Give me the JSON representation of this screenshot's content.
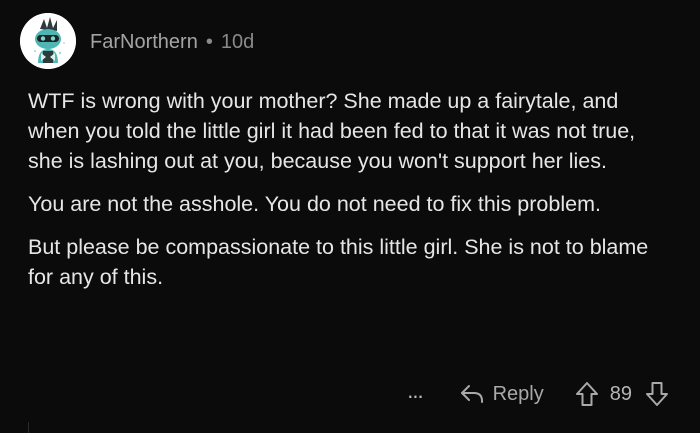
{
  "comment": {
    "username": "FarNorthern",
    "separator": "•",
    "age": "10d",
    "paragraphs": [
      "WTF is wrong with your mother? She made up a fairytale, and when you told the little girl it had been fed to that it was not true, she is lashing out at you, because you won't support her lies.",
      "You are not the asshole. You do not need to fix this problem.",
      "But please be compassionate to this little girl. She is not to blame for any of this."
    ]
  },
  "actions": {
    "more_label": "...",
    "reply_label": "Reply",
    "score": "89"
  },
  "icons": {
    "avatar": "snoo-avatar-icon",
    "reply": "reply-arrow-icon",
    "upvote": "upvote-arrow-icon",
    "downvote": "downvote-arrow-icon"
  },
  "colors": {
    "background": "#0b0b0b",
    "text": "#e6e6e6",
    "muted": "#a4a4a4"
  }
}
